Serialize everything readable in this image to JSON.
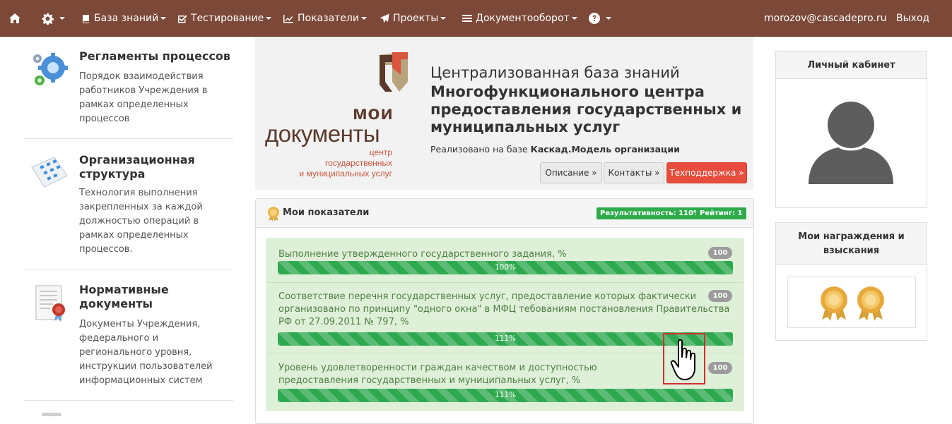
{
  "nav": {
    "items": [
      {
        "label": "База знаний",
        "icon": "book-icon"
      },
      {
        "label": "Тестирование",
        "icon": "checkbox-icon"
      },
      {
        "label": "Показатели",
        "icon": "line-chart-icon"
      },
      {
        "label": "Проекты",
        "icon": "send-icon"
      },
      {
        "label": "Документооборот",
        "icon": "list-icon"
      }
    ],
    "user": "morozov@cascadepro.ru",
    "logout": "Выход"
  },
  "left": {
    "items": [
      {
        "title": "Регламенты процессов",
        "text": [
          "Порядок взаимодействия",
          "работников Учреждения в",
          "рамках определенных",
          "процессов"
        ]
      },
      {
        "title": "Организационная структура",
        "title_lines": [
          "Организационная",
          "структура"
        ],
        "text": [
          "Технология выполнения",
          "закрепленных за каждой",
          "должностью операций в",
          "рамках определенных",
          "процессов."
        ]
      },
      {
        "title": "Нормативные документы",
        "title_lines": [
          "Нормативные",
          "документы"
        ],
        "text": [
          "Документы Учреждения,",
          "федерального и",
          "регионального уровня,",
          "инструкции пользователей",
          "информационных систем"
        ]
      }
    ]
  },
  "banner": {
    "logo_moi": "мои",
    "logo_docs": "документы",
    "logo_sub": [
      "центр",
      "государственных",
      "и муниципальных услуг"
    ],
    "line1": "Централизованная база знаний",
    "line2": "Многофункционального центра предоставления государственных и муниципальных услуг",
    "impl_prefix": "Реализовано на базе",
    "impl_name": "Каскад.Модель организации",
    "btn_desc": "Описание »",
    "btn_contacts": "Контакты »",
    "btn_support": "Техподдержка »"
  },
  "indicators": {
    "title": "Мои показатели",
    "effectiveness": "Результативность: 110%",
    "rating": "Рейтинг: 1",
    "items": [
      {
        "text": "Выполнение утвержденного государственного задания, %",
        "score": "100",
        "progress": "100%"
      },
      {
        "text": "Соответствие перечня государственных услуг, предоставление которых фактически организовано по принципу \"одного окна\" в МФЦ тебованиям постановления Правительства РФ от 27.09.2011 № 797, %",
        "score": "100",
        "progress": "111%"
      },
      {
        "text": "Уровень удовлетворенности граждан качеством и доступностью предоставления государственных и муниципальных услуг, %",
        "score": "100",
        "progress": "111%"
      }
    ]
  },
  "right": {
    "cabinet": "Личный кабинет",
    "awards_lines": [
      "Мои награждения и",
      "взыскания"
    ]
  },
  "colors": {
    "navbar": "#7c4838",
    "success": "#2ea94f",
    "danger": "#e74c3c",
    "kpi_bg": "#dff0d8"
  }
}
